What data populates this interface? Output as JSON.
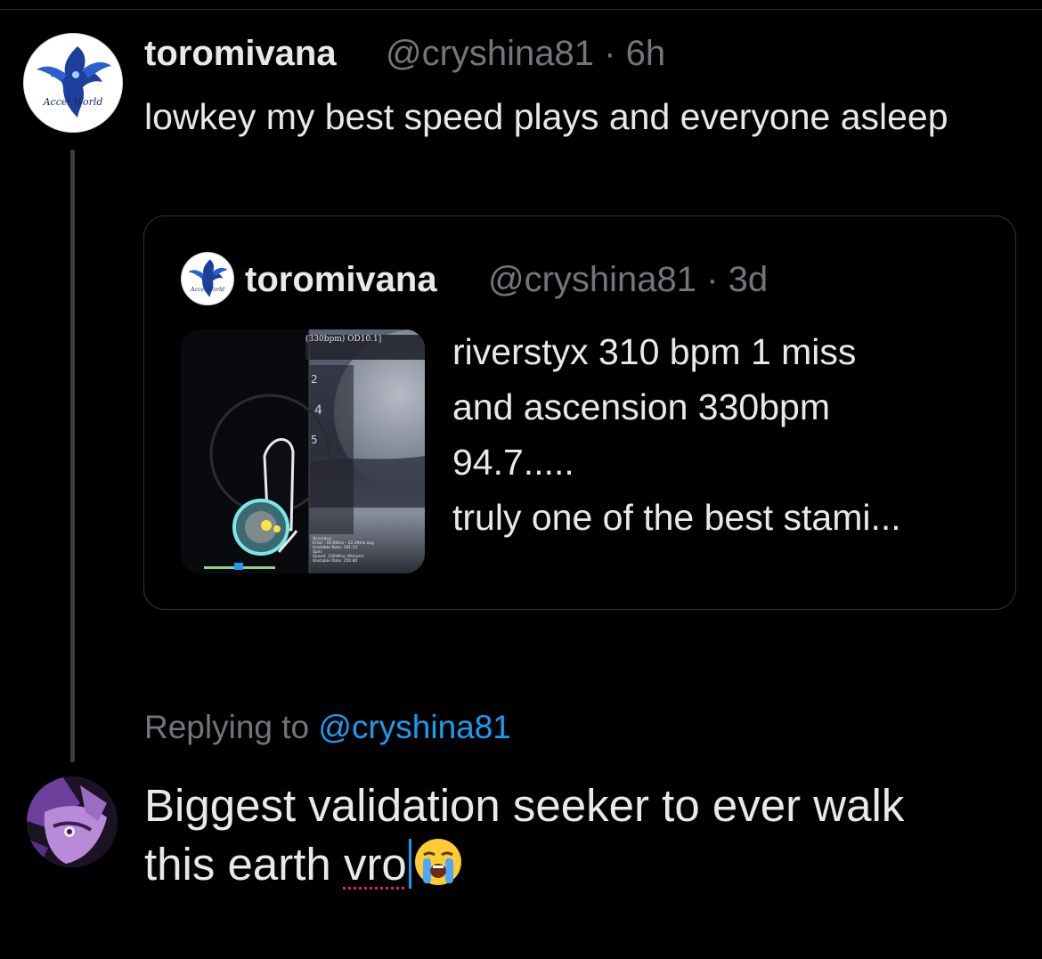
{
  "main_post": {
    "display_name": "toromivana",
    "handle_time": "@cryshina81 · 6h",
    "text": "lowkey my best speed plays and everyone asleep",
    "avatar": {
      "logo_text": "Accel World"
    }
  },
  "quoted_post": {
    "display_name": "toromivana",
    "handle_time": "@cryshina81 · 3d",
    "avatar": {
      "logo_text": "Accel World"
    },
    "text_lines": [
      "riverstyx 310 bpm 1 miss",
      "and ascension 330bpm",
      "94.7.....",
      "truly one of the best stami..."
    ],
    "media": {
      "header_text": "(330bpm) OD10.1]",
      "lane_numbers": [
        "2",
        "4",
        "5"
      ],
      "stats_lines": [
        "Accuracy:",
        "Error: -10.60ms - 12.29ms avg",
        "Unstable Rate: 161.12",
        "Spin:",
        "Speed: 330(Max:394rpm)",
        "Unstable Rate: 250.80"
      ]
    }
  },
  "reply_context": {
    "prefix": "Replying to",
    "mention": "@cryshina81"
  },
  "compose": {
    "line1": "Biggest validation seeker to ever walk",
    "line2_before": "this earth",
    "misspelled_word": "vro",
    "emoji_name": "loudly-crying-face-emoji"
  },
  "colors": {
    "background": "#000000",
    "text_primary": "#e7e9ea",
    "text_secondary": "#71767b",
    "accent_blue": "#1d9bf0",
    "spellcheck_red": "#e0245e",
    "border": "#2f3336"
  }
}
